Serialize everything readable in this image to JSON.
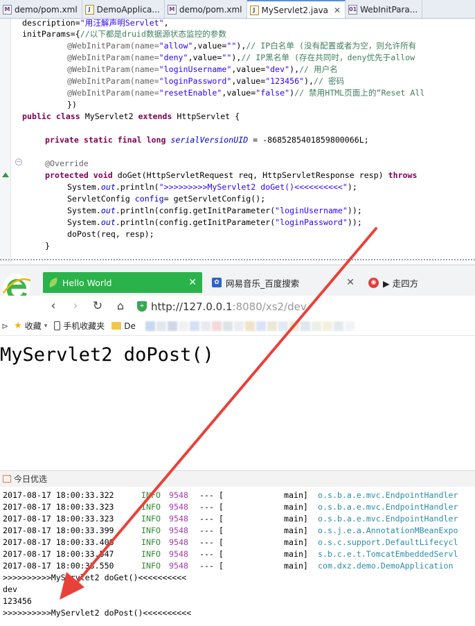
{
  "editor": {
    "tabs": [
      {
        "label": "demo/pom.xml",
        "icon": "maven-file-icon",
        "active": false
      },
      {
        "label": "DemoApplica...",
        "icon": "java-file-icon",
        "active": false
      },
      {
        "label": "demo/pom.xml",
        "icon": "maven-file-icon",
        "active": false
      },
      {
        "label": "MyServlet2.java",
        "icon": "java-file-icon",
        "active": true
      },
      {
        "label": "WebInitPara...",
        "icon": "class-file-icon",
        "active": false
      }
    ],
    "close_glyph": "✕",
    "code": {
      "l1a": "description=",
      "l1b": "\"用汪解声明Servlet\"",
      "l1c": ",",
      "l2a": "initParams={",
      "l2b": "//以下都是druid数据源状态监控的参数",
      "l3a": "@WebInitParam(name=",
      "l3b": "\"allow\"",
      "l3c": ",value=",
      "l3d": "\"\"",
      "l3e": "),",
      "l3f": "// IP白名单 (没有配置或者为空，则允许所有",
      "l4b": "\"deny\"",
      "l4f": "// IP黑名单 (存在共同时，deny优先于allow",
      "l5b": "\"loginUsername\"",
      "l5d": "\"dev\"",
      "l5f": "// 用户名",
      "l6b": "\"loginPassword\"",
      "l6d": "\"123456\"",
      "l6f": "// 密码",
      "l7b": "\"resetEnable\"",
      "l7d": "\"false\"",
      "l7e": ")",
      "l7f": "// 禁用HTML页面上的“Reset All",
      "l8": "})",
      "l9a": "public class",
      "l9b": " MyServlet2 ",
      "l9c": "extends",
      "l9d": " HttpServlet {",
      "l10a": "private static final long",
      "l10b": "serialVersionUID",
      "l10c": " = -8685285401859800066L;",
      "l11": "@Override",
      "l12a": "protected void",
      "l12b": " doGet(HttpServletRequest req, HttpServletResponse resp) ",
      "l12c": "throws",
      "l13a": "System.",
      "l13b": "out",
      "l13c": ".println(",
      "l13d": "\">>>>>>>>>MyServlet2 doGet()<<<<<<<<<<\"",
      "l13e": ");",
      "l14a": "ServletConfig ",
      "l14b": "config",
      "l14c": "= getServletConfig();",
      "l15c": ".println(config.getInitParameter(",
      "l15d": "\"loginUsername\"",
      "l15e": "));",
      "l16d": "\"loginPassword\"",
      "l17": "doPost(req, resp);",
      "l18": "}"
    }
  },
  "browser": {
    "tabs": [
      {
        "label": "Hello World",
        "close": "✕"
      },
      {
        "label": "网易音乐_百度搜索",
        "close": "✕"
      },
      {
        "label": "▶ 走四方"
      }
    ],
    "url_host": "http://127.0.0.1",
    "url_rest": ":8080/xs2/dev",
    "bookmarks": {
      "favorites": "收藏",
      "mobile": "手机收藏夹",
      "folder": "De"
    },
    "page_text": "MyServlet2 doPost()",
    "status_label": "今日优选"
  },
  "console": {
    "lines": [
      {
        "date": "2017-08-17 18:00:33.322",
        "level": "INFO",
        "pid": "9548",
        "sep": "--- [",
        "thread": "main]",
        "logger": "o.s.b.a.e.mvc.EndpointHandler"
      },
      {
        "date": "2017-08-17 18:00:33.323",
        "level": "INFO",
        "pid": "9548",
        "sep": "--- [",
        "thread": "main]",
        "logger": "o.s.b.a.e.mvc.EndpointHandler"
      },
      {
        "date": "2017-08-17 18:00:33.323",
        "level": "INFO",
        "pid": "9548",
        "sep": "--- [",
        "thread": "main]",
        "logger": "o.s.b.a.e.mvc.EndpointHandler"
      },
      {
        "date": "2017-08-17 18:00:33.399",
        "level": "INFO",
        "pid": "9548",
        "sep": "--- [",
        "thread": "main]",
        "logger": "o.s.j.e.a.AnnotationMBeanExpo"
      },
      {
        "date": "2017-08-17 18:00:33.406",
        "level": "INFO",
        "pid": "9548",
        "sep": "--- [",
        "thread": "main]",
        "logger": "o.s.c.support.DefaultLifecycl"
      },
      {
        "date": "2017-08-17 18:00:33.547",
        "level": "INFO",
        "pid": "9548",
        "sep": "--- [",
        "thread": "main]",
        "logger": "s.b.c.e.t.TomcatEmbeddedServl"
      },
      {
        "date": "2017-08-17 18:00:33.550",
        "level": "INFO",
        "pid": "9548",
        "sep": "--- [",
        "thread": "main]",
        "logger": "com.dxz.demo.DemoApplication"
      }
    ],
    "out1": ">>>>>>>>>>MyServlet2 doGet()<<<<<<<<<<",
    "out2": "dev",
    "out3": "123456",
    "out4": ">>>>>>>>>>MyServlet2 doPost()<<<<<<<<<<"
  },
  "colors": {
    "arrow": "#e8413a",
    "browser_tab_active": "#29b34a",
    "java_keyword": "#7f0055",
    "java_string": "#2a00ff",
    "java_comment": "#3f7f5f"
  }
}
